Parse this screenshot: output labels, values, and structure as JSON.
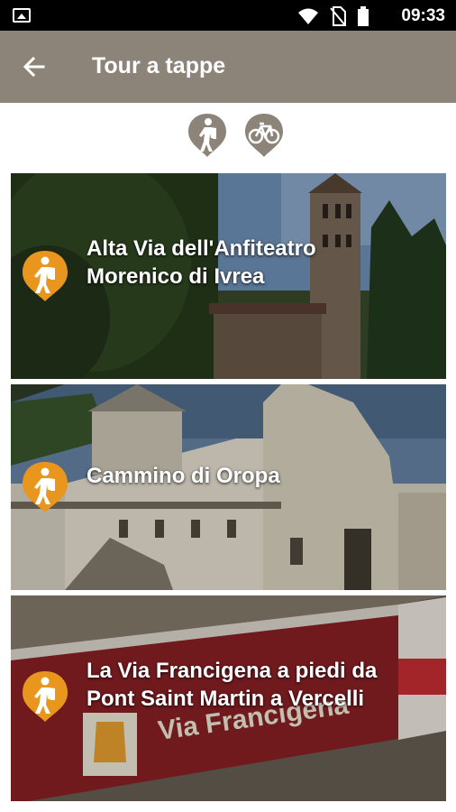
{
  "status_bar": {
    "time": "09:33"
  },
  "app_bar": {
    "title": "Tour a tappe"
  },
  "mode_switch": {
    "items": [
      {
        "icon": "hiking-icon",
        "selected": true
      },
      {
        "icon": "bicycle-icon",
        "selected": false
      }
    ]
  },
  "tours": [
    {
      "title_line1": "Alta Via dell'Anfiteatro",
      "title_line2": "Morenico di Ivrea",
      "icon": "hiking-pin-icon"
    },
    {
      "title_line1": "Cammino di Oropa",
      "title_line2": "",
      "icon": "hiking-pin-icon"
    },
    {
      "title_line1": "La Via Francigena a piedi da",
      "title_line2": "Pont Saint Martin a Vercelli",
      "icon": "hiking-pin-icon"
    }
  ],
  "colors": {
    "app_bar": "#8d8479",
    "pin_orange": "#e8961e",
    "icon_gray": "#8d8479"
  }
}
